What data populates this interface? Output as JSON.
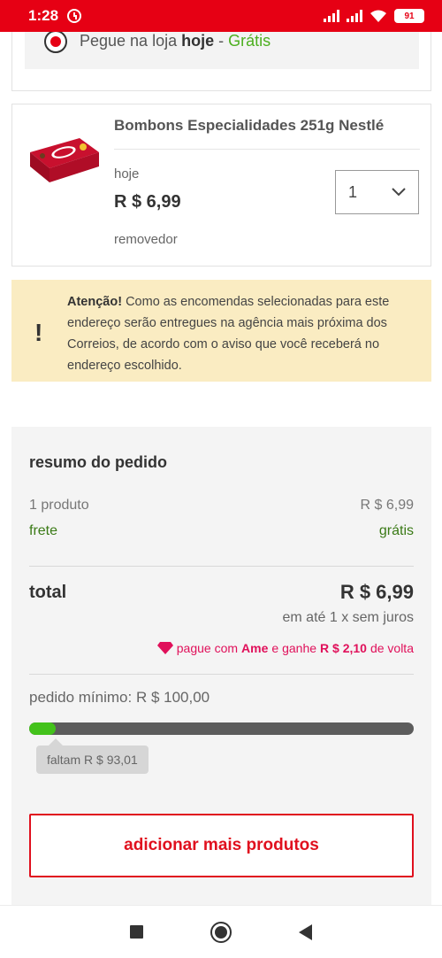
{
  "status_bar": {
    "time": "1:28",
    "battery": "91"
  },
  "pickup": {
    "text_prefix": "Pegue na loja",
    "when": "hoje",
    "separator": "-",
    "price": "Grátis"
  },
  "product": {
    "name": "Bombons Especialidades 251g Nestlé",
    "when": "hoje",
    "price": "R $ 6,99",
    "remove_label": "removedor",
    "quantity": "1"
  },
  "notice": {
    "icon": "!",
    "title": "Atenção!",
    "body": "Como as encomendas selecionadas para este endereço serão entregues na agência mais próxima dos Correios, de acordo com o aviso que você receberá no endereço escolhido."
  },
  "summary": {
    "title": "resumo do pedido",
    "products_label": "1 produto",
    "products_value": "R $ 6,99",
    "shipping_label": "frete",
    "shipping_value": "grátis",
    "total_label": "total",
    "total_value": "R $ 6,99",
    "installments": "em até 1 x sem juros",
    "ame_prefix": "pague com",
    "ame_brand": "Ame",
    "ame_middle": "e ganhe",
    "ame_cashback": "R $ 2,10",
    "ame_suffix": "de volta",
    "min_order": "pedido mínimo: R $ 100,00",
    "progress_fraction": 0.0699,
    "missing": "faltam R $ 93,01",
    "add_button": "adicionar mais produtos"
  },
  "colors": {
    "brand_red": "#e60014",
    "progress_green": "#43c21b",
    "ame_pink": "#e0105a"
  }
}
